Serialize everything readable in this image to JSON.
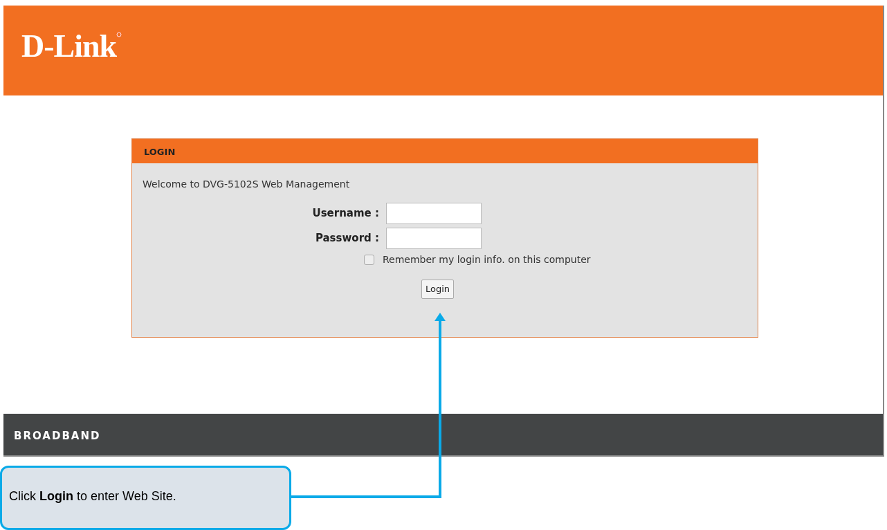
{
  "header": {
    "logo": "D-Link"
  },
  "panel": {
    "title": "LOGIN",
    "welcome": "Welcome to DVG-5102S Web Management",
    "fields": [
      {
        "label": "Username :"
      },
      {
        "label": "Password :"
      }
    ],
    "remember": {
      "label": "Remember my login info. on this computer",
      "checked": false
    },
    "button": "Login"
  },
  "footer": {
    "brand": "BROADBAND"
  },
  "callout": {
    "text": "Click **Login** to enter Web Site."
  }
}
